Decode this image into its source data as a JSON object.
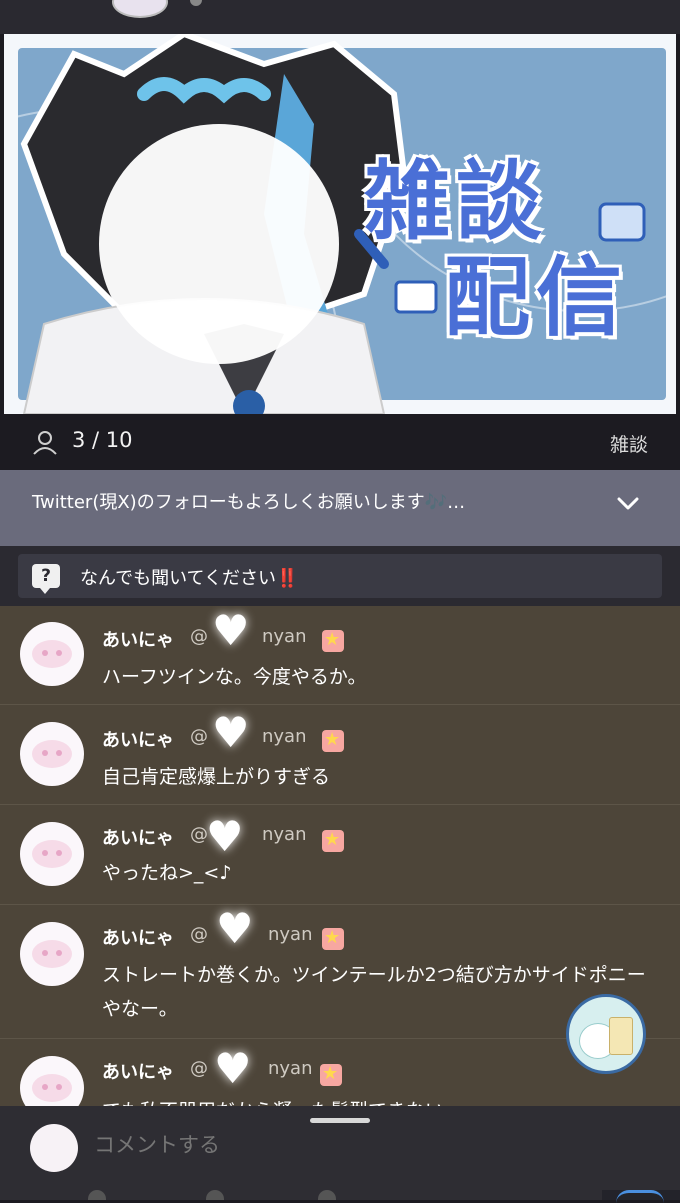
{
  "stream": {
    "title_lines": [
      "雑談",
      "配信"
    ],
    "viewers": "3 / 10",
    "category": "雑談",
    "description": "Twitter(現X)のフォローもよろしくお願いします🎶…",
    "question_prompt": "なんでも聞いてください",
    "question_emphasis": "‼️"
  },
  "comments": [
    {
      "name": "あいにゃ",
      "handle_prefix": "@",
      "handle_suffix": "nyan",
      "text": "ハーフツインな。今度やるか。"
    },
    {
      "name": "あいにゃ",
      "handle_prefix": "@",
      "handle_suffix": "nyan",
      "text": "自己肯定感爆上がりすぎる"
    },
    {
      "name": "あいにゃ",
      "handle_prefix": "@",
      "handle_suffix": "nyan",
      "text": "やったね>_<♪"
    },
    {
      "name": "あいにゃ",
      "handle_prefix": "@",
      "handle_suffix": "nyan",
      "text": "ストレートか巻くか。ツインテールか2つ結び方かサイドポニーやなー。"
    },
    {
      "name": "あいにゃ",
      "handle_prefix": "@",
      "handle_suffix": "nyan",
      "text": "でも私不器用だから凝った髪型できない"
    }
  ],
  "composer": {
    "placeholder": "コメントする"
  },
  "colors": {
    "accent": "#4a6fd6",
    "background": "#1c1b21",
    "comment_bg": "#4d4539",
    "description_bg": "#6a6b7c"
  },
  "icons": {
    "viewers": "person-icon",
    "expand": "chevron-down-icon",
    "question": "question-bubble-icon",
    "badge": "star-badge-icon"
  }
}
